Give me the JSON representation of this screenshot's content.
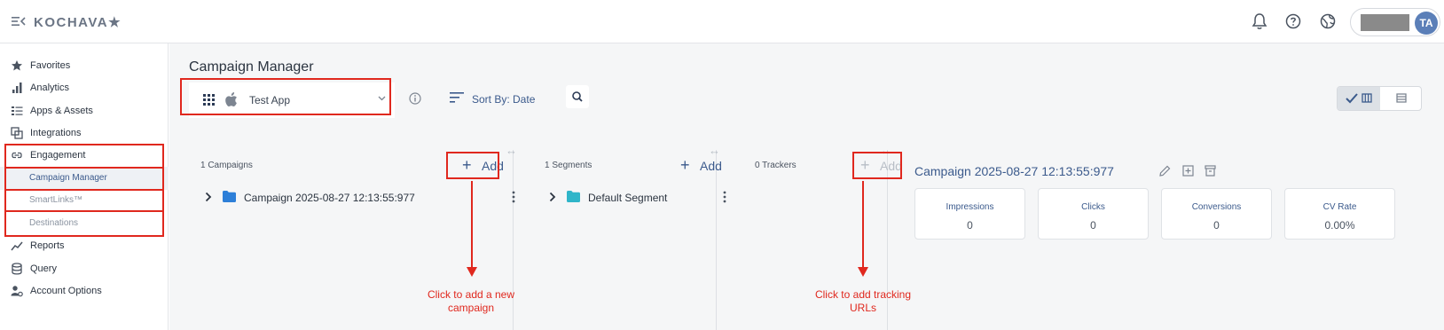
{
  "topbar": {
    "logo_text": "KOCHAVA★",
    "avatar_initials": "TA",
    "icons": [
      "menu-collapse-icon",
      "bell-icon",
      "help-icon",
      "globe-icon"
    ]
  },
  "sidebar": {
    "items": [
      {
        "label": "Favorites",
        "icon": "star-icon"
      },
      {
        "label": "Analytics",
        "icon": "bar-chart-icon"
      },
      {
        "label": "Apps & Assets",
        "icon": "list-icon"
      },
      {
        "label": "Integrations",
        "icon": "integrations-icon"
      },
      {
        "label": "Engagement",
        "icon": "link-icon"
      },
      {
        "label": "Reports",
        "icon": "trend-icon"
      },
      {
        "label": "Query",
        "icon": "database-icon"
      },
      {
        "label": "Account Options",
        "icon": "user-gear-icon"
      }
    ],
    "subitems": [
      {
        "label": "Campaign Manager",
        "active": true
      },
      {
        "label": "SmartLinks™",
        "active": false
      },
      {
        "label": "Destinations",
        "active": false
      }
    ]
  },
  "main": {
    "title": "Campaign Manager",
    "app_selector": {
      "value": "Test App"
    },
    "sort_label": "Sort  By: Date",
    "columns": {
      "campaigns": {
        "count_label": "1 Campaigns",
        "add_label": "Add",
        "row_label": "Campaign 2025-08-27 12:13:55:977"
      },
      "segments": {
        "count_label": "1 Segments",
        "add_label": "Add",
        "row_label": "Default Segment"
      },
      "trackers": {
        "count_label": "0 Trackers",
        "add_label": "Add"
      }
    },
    "detail": {
      "title": "Campaign 2025-08-27 12:13:55:977",
      "stats": [
        {
          "label": "Impressions",
          "value": "0"
        },
        {
          "label": "Clicks",
          "value": "0"
        },
        {
          "label": "Conversions",
          "value": "0"
        },
        {
          "label": "CV Rate",
          "value": "0.00%"
        }
      ]
    }
  },
  "annotations": {
    "campaign_note": [
      "Click to add a new",
      "campaign"
    ],
    "tracker_note": [
      "Click to add tracking",
      "URLs"
    ],
    "color": "#e0281e"
  },
  "colors": {
    "accent": "#3b5a8c",
    "annotation": "#e0281e",
    "folder_blue": "#2d7fd8",
    "folder_teal": "#2fb5c9"
  }
}
